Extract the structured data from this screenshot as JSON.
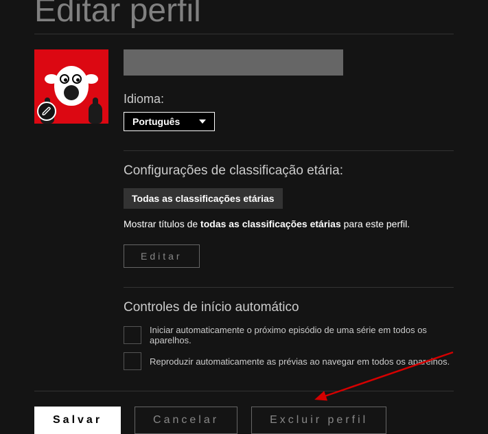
{
  "title": "Editar perfil",
  "language": {
    "label": "Idioma:",
    "selected": "Português"
  },
  "maturity": {
    "heading": "Configurações de classificação etária:",
    "badge": "Todas as classificações etárias",
    "desc_prefix": "Mostrar títulos de ",
    "desc_bold": "todas as classificações etárias",
    "desc_suffix": " para este perfil.",
    "edit_button": "Editar"
  },
  "autoplay": {
    "heading": "Controles de início automático",
    "option1": "Iniciar automaticamente o próximo episódio de uma série em todos os aparelhos.",
    "option2": "Reproduzir automaticamente as prévias ao navegar em todos os aparelhos."
  },
  "buttons": {
    "save": "Salvar",
    "cancel": "Cancelar",
    "delete": "Excluir perfil"
  },
  "profile_name": ""
}
